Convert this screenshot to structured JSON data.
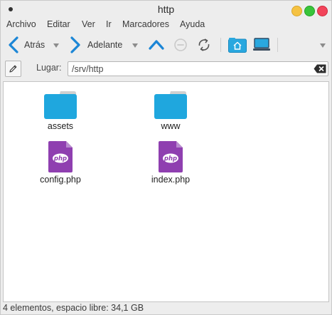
{
  "window": {
    "title": "http"
  },
  "menubar": {
    "items": [
      "Archivo",
      "Editar",
      "Ver",
      "Ir",
      "Marcadores",
      "Ayuda"
    ]
  },
  "toolbar": {
    "back_label": "Atrás",
    "forward_label": "Adelante"
  },
  "location": {
    "label": "Lugar:",
    "path": "/srv/http"
  },
  "files": [
    {
      "name": "assets",
      "type": "folder"
    },
    {
      "name": "www",
      "type": "folder"
    },
    {
      "name": "config.php",
      "type": "php"
    },
    {
      "name": "index.php",
      "type": "php"
    }
  ],
  "status": {
    "text": "4 elementos, espacio libre: 34,1 GB"
  },
  "colors": {
    "folder": "#1fa7de",
    "php_file": "#8f3fb0",
    "nav_arrow": "#1c86d6",
    "accent_button": "#2aa8df"
  }
}
